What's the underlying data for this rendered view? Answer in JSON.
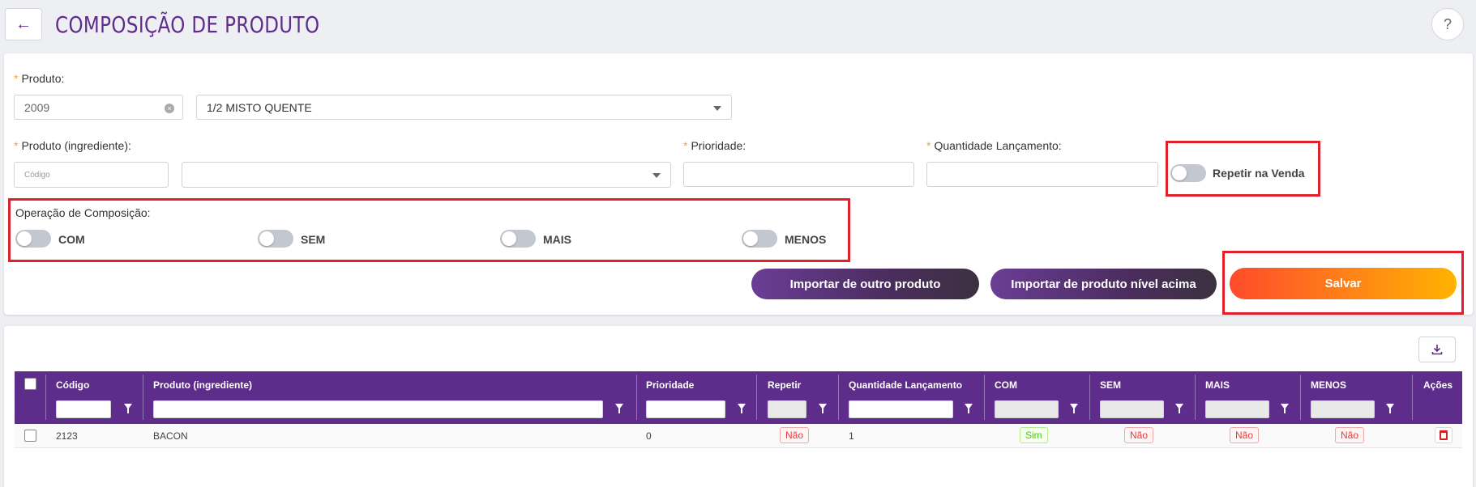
{
  "header": {
    "back_icon": "←",
    "title": "COMPOSIÇÃO DE PRODUTO",
    "help_icon": "?"
  },
  "form": {
    "produto_label": "Produto",
    "produto_code": "2009",
    "produto_name": "1/2 MISTO QUENTE",
    "ingrediente_label": "Produto (ingrediente)",
    "ingrediente_code_placeholder": "Código",
    "prioridade_label": "Prioridade",
    "quantidade_label": "Quantidade Lançamento",
    "repetir_label": "Repetir na Venda",
    "operacao_label": "Operação de Composição",
    "operacoes": [
      "COM",
      "SEM",
      "MAIS",
      "MENOS"
    ],
    "import_other_label": "Importar de outro produto",
    "import_level_label": "Importar de produto nível acima",
    "save_label": "Salvar",
    "colon": ":"
  },
  "table": {
    "export_icon": "download-icon",
    "columns": [
      "Código",
      "Produto (ingrediente)",
      "Prioridade",
      "Repetir",
      "Quantidade Lançamento",
      "COM",
      "SEM",
      "MAIS",
      "MENOS",
      "Ações"
    ],
    "rows": [
      {
        "codigo": "2123",
        "produto": "BACON",
        "prioridade": "0",
        "repetir": "Não",
        "quantidade": "1",
        "com": "Sim",
        "sem": "Não",
        "mais": "Não",
        "menos": "Não"
      }
    ]
  },
  "colors": {
    "primary": "#5e2d8c",
    "accent_orange": "#ff7a1a",
    "highlight_red": "#e0202a"
  }
}
